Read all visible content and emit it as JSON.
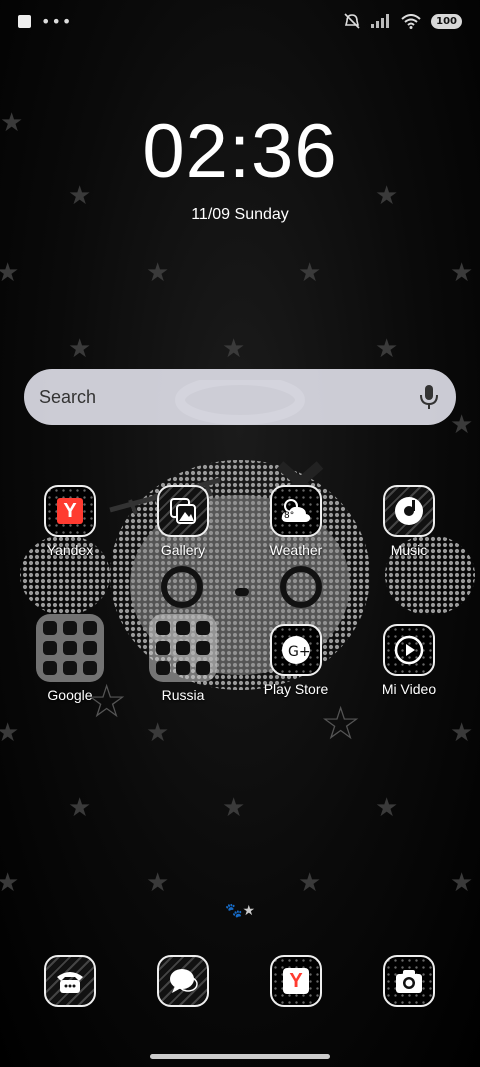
{
  "status_bar": {
    "battery": "100",
    "left_icons": [
      "notification-square-icon",
      "more-dots-icon"
    ],
    "right_icons": [
      "mute-icon",
      "signal-icon",
      "wifi-icon",
      "battery-icon"
    ]
  },
  "lockscreen": {
    "time": "02:36",
    "date": "11/09 Sunday"
  },
  "search": {
    "placeholder": "Search",
    "mic_icon": "mic-icon"
  },
  "apps": [
    {
      "label": "Yandex",
      "icon": "yandex-icon"
    },
    {
      "label": "Gallery",
      "icon": "gallery-icon"
    },
    {
      "label": "Weather",
      "icon": "weather-icon",
      "temp": "8°"
    },
    {
      "label": "Music",
      "icon": "music-icon"
    },
    {
      "label": "Google",
      "icon": "google-folder-icon"
    },
    {
      "label": "Russia",
      "icon": "russia-folder-icon"
    },
    {
      "label": "Play Store",
      "icon": "play-store-icon"
    },
    {
      "label": "Mi Video",
      "icon": "mi-video-icon"
    }
  ],
  "dock": [
    {
      "icon": "phone-icon"
    },
    {
      "icon": "messages-icon"
    },
    {
      "icon": "yandex-browser-icon"
    },
    {
      "icon": "camera-icon"
    }
  ],
  "colors": {
    "background": "#000000",
    "search_bg": "#e1e1eb",
    "yandex_red": "#ff3b30"
  }
}
